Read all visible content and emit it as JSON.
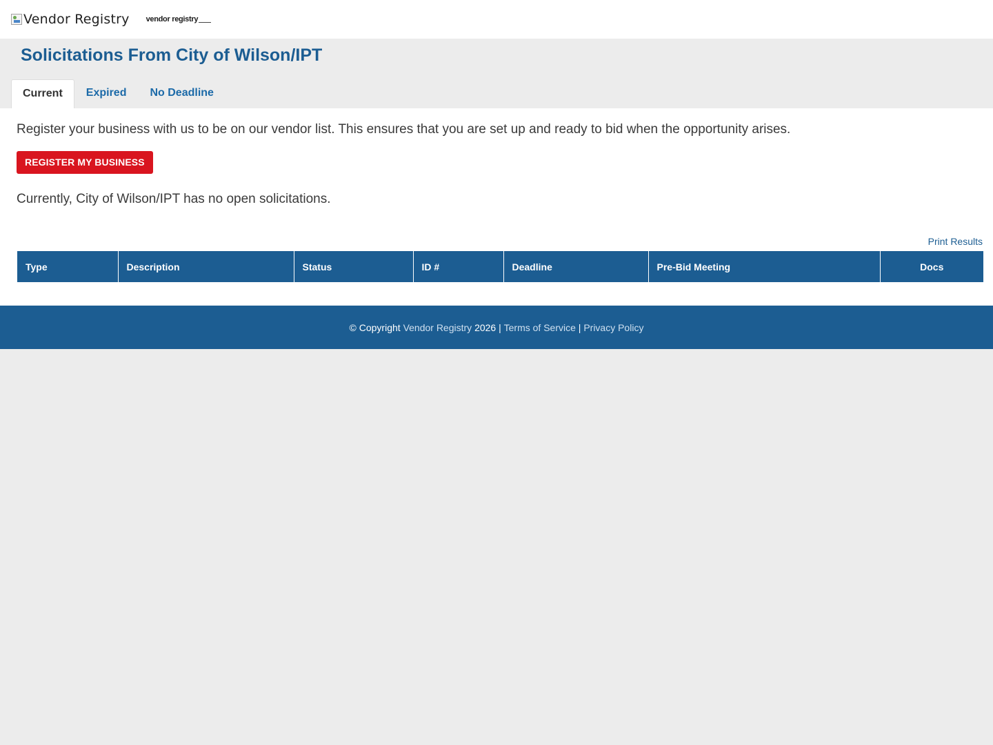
{
  "topbar": {
    "broken_logo_alt": "Vendor Registry",
    "logo_text": "vendor registry",
    "logo_tagline": ""
  },
  "page": {
    "title": "Solicitations From City of Wilson/IPT"
  },
  "tabs": [
    {
      "label": "Current",
      "active": true
    },
    {
      "label": "Expired",
      "active": false
    },
    {
      "label": "No Deadline",
      "active": false
    }
  ],
  "content": {
    "intro": "Register your business with us to be on our vendor list. This ensures that you are set up and ready to bid when the opportunity arises.",
    "register_button": "REGISTER MY BUSINESS",
    "no_open_text": "Currently, City of Wilson/IPT has no open solicitations.",
    "print_link": "Print Results"
  },
  "table": {
    "columns": [
      "Type",
      "Description",
      "Status",
      "ID #",
      "Deadline",
      "Pre-Bid Meeting",
      "Docs"
    ],
    "rows": []
  },
  "footer": {
    "copyright_prefix": "© Copyright",
    "vendor_registry_link": "Vendor Registry",
    "year": "2026",
    "sep1": "|",
    "terms_link": "Terms of Service",
    "sep2": "|",
    "privacy_link": "Privacy Policy"
  },
  "colors": {
    "brand_blue": "#1c5d92",
    "button_red": "#d9151f",
    "background_gray": "#ececec"
  }
}
